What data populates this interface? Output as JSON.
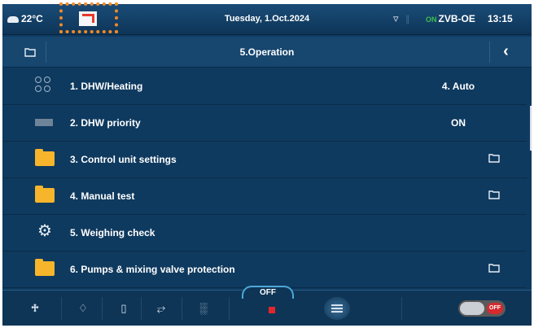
{
  "status": {
    "temperature": "22°C",
    "date": "Tuesday, 1.Oct.2024",
    "device_badge": "ON",
    "device": "ZVB-OE",
    "time": "13:15"
  },
  "title": "5.Operation",
  "menu": [
    {
      "label": "1. DHW/Heating",
      "value": "4. Auto",
      "icon": "dhw-heating-icon"
    },
    {
      "label": "2. DHW priority",
      "value": "ON",
      "icon": "priority-icon"
    },
    {
      "label": "3. Control unit settings",
      "value": "",
      "icon": "folder-icon",
      "submenu": true
    },
    {
      "label": "4. Manual test",
      "value": "",
      "icon": "folder-icon",
      "submenu": true
    },
    {
      "label": "5. Weighing check",
      "value": "",
      "icon": "gear-icon"
    },
    {
      "label": "6. Pumps & mixing valve protection",
      "value": "",
      "icon": "folder-icon",
      "submenu": true
    }
  ],
  "bottom": {
    "mode_label": "OFF",
    "toggle_label": "OFF",
    "back_glyph": "‹"
  },
  "colors": {
    "background": "#0f3a5f",
    "highlight": "#f28a26",
    "folder": "#f7b52b",
    "stop": "#e3262c"
  }
}
